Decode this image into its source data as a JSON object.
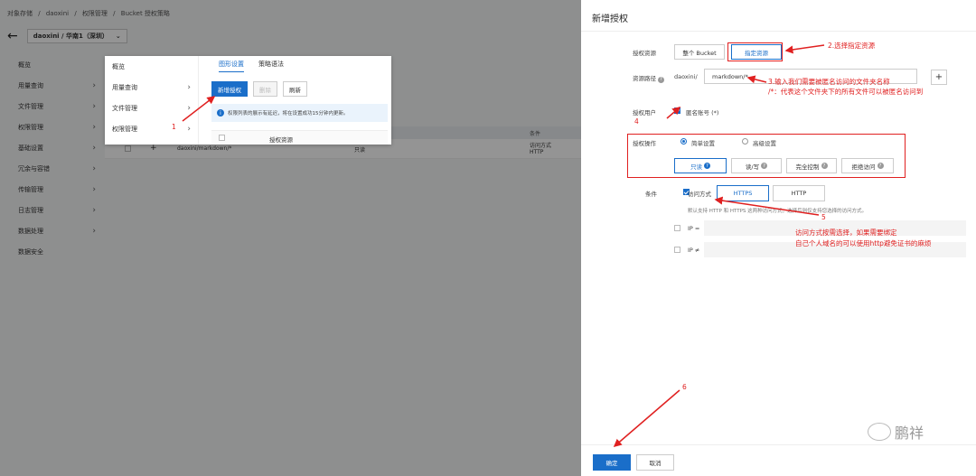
{
  "background_page": {
    "breadcrumb": [
      "对象存储",
      "/",
      "daoxini",
      "/",
      "权限管理",
      "/",
      "Bucket 授权策略"
    ],
    "bucket_selector": "daoxini / 华南1（深圳）",
    "left_nav": [
      "概览",
      "用量查询",
      "文件管理",
      "权限管理",
      "基础设置",
      "冗余与容错",
      "传输管理",
      "日志管理",
      "数据处理",
      "数据安全"
    ],
    "table": {
      "headers": [
        "授权资源",
        "条件"
      ],
      "row": {
        "resource": "daoxini/markdown/*",
        "permission": "只读",
        "condition_1": "访问方式",
        "condition_2": "HTTP"
      }
    }
  },
  "popup": {
    "nav": [
      "概览",
      "用量查询",
      "文件管理",
      "权限管理"
    ],
    "tabs": [
      "图形设置",
      "策略语法"
    ],
    "toolbar": {
      "add": "新增授权",
      "delete": "删除",
      "refresh": "刷新"
    },
    "info": "权限列表的展示有延迟，将在设置成功15分钟内更新。",
    "table_header": "授权资源"
  },
  "drawer": {
    "title": "新增授权",
    "auth_resource": {
      "label": "授权资源",
      "options": [
        "整个 Bucket",
        "指定资源"
      ],
      "selected": "指定资源"
    },
    "resource_path": {
      "label": "资源路径",
      "prefix": "daoxini/",
      "value": "markdown/*",
      "add_symbol": "+"
    },
    "auth_user": {
      "label": "授权用户",
      "option": "匿名账号 (*)",
      "checked": true
    },
    "auth_ops": {
      "label": "授权操作",
      "radios": [
        "简单设置",
        "高级设置"
      ],
      "selected": "简单设置",
      "buttons": [
        "只读",
        "读/写",
        "完全控制",
        "拒绝访问"
      ],
      "selected_button": "只读"
    },
    "condition": {
      "label": "条件",
      "access_label": "访问方式",
      "protocols": [
        "HTTPS",
        "HTTP"
      ],
      "selected_protocol": "HTTPS",
      "hint": "默认支持 HTTP 和 HTTPS 这两种访问方式，选择后则仅支持您选择的访问方式。",
      "ip_eq": "IP =",
      "ip_ne": "IP ≠"
    },
    "footer": {
      "confirm": "确定",
      "cancel": "取消"
    }
  },
  "annotations": {
    "a1": "1",
    "a2": "2.选择指定资源",
    "a3_line1": "3.输入我们需要被匿名访问的文件夹名称",
    "a3_line2": "/*：代表这个文件夹下的所有文件可以被匿名访问到",
    "a4": "4",
    "a5": "5",
    "a5_line1": "访问方式按需选择，如果需要绑定",
    "a5_line2": "自己个人域名的可以使用http避免证书的麻烦",
    "a6": "6"
  },
  "watermark": "鹏祥",
  "colors": {
    "accent": "#1a6ec9",
    "annotation_red": "#e02020"
  }
}
